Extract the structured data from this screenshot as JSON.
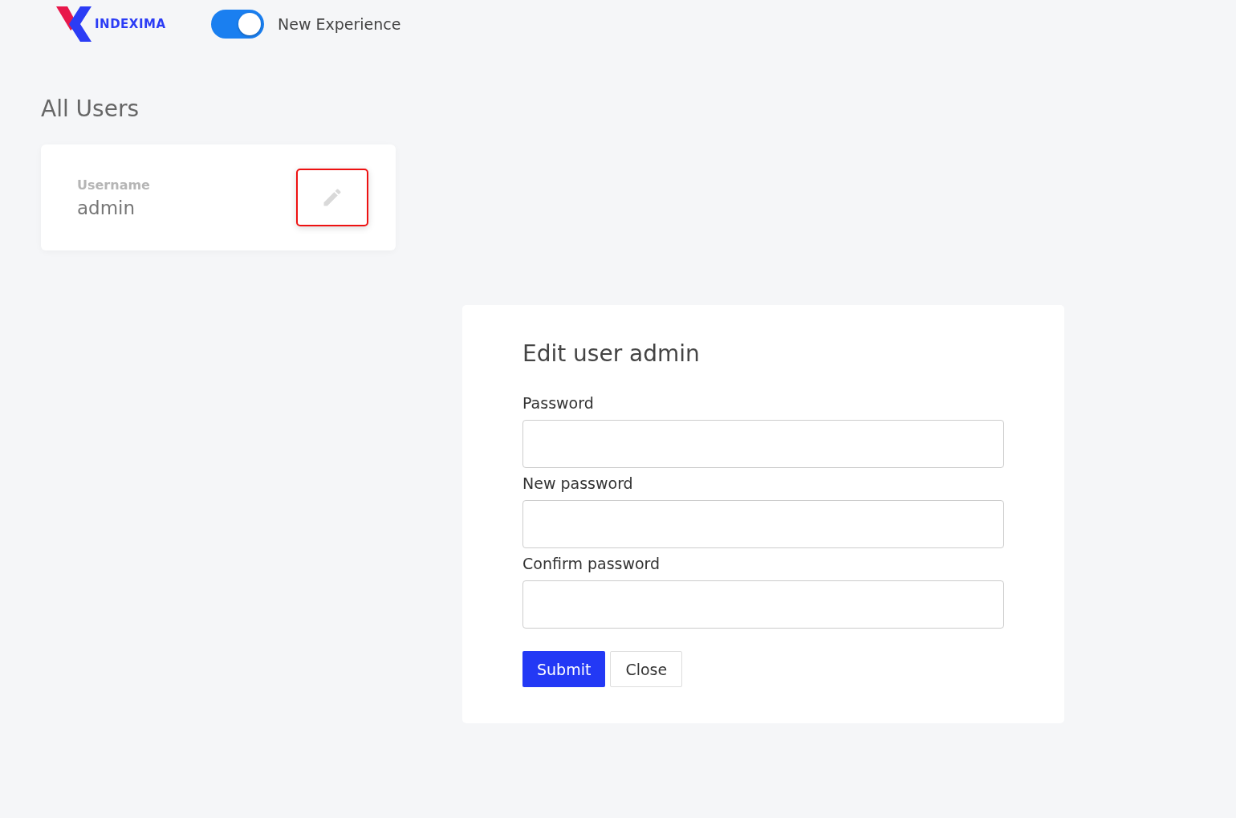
{
  "header": {
    "logo_text": "INDEXIMA",
    "toggle": {
      "label": "New Experience",
      "on": true
    }
  },
  "page_title": "All Users",
  "user_card": {
    "field_label": "Username",
    "value": "admin",
    "edit_button": {
      "focused": true
    }
  },
  "dialog": {
    "title": "Edit user admin",
    "fields": [
      {
        "label": "Password"
      },
      {
        "label": "New password"
      },
      {
        "label": "Confirm password"
      }
    ],
    "buttons": [
      {
        "label": "Submit",
        "kind": "primary"
      },
      {
        "label": "Close",
        "kind": "secondary"
      }
    ]
  }
}
